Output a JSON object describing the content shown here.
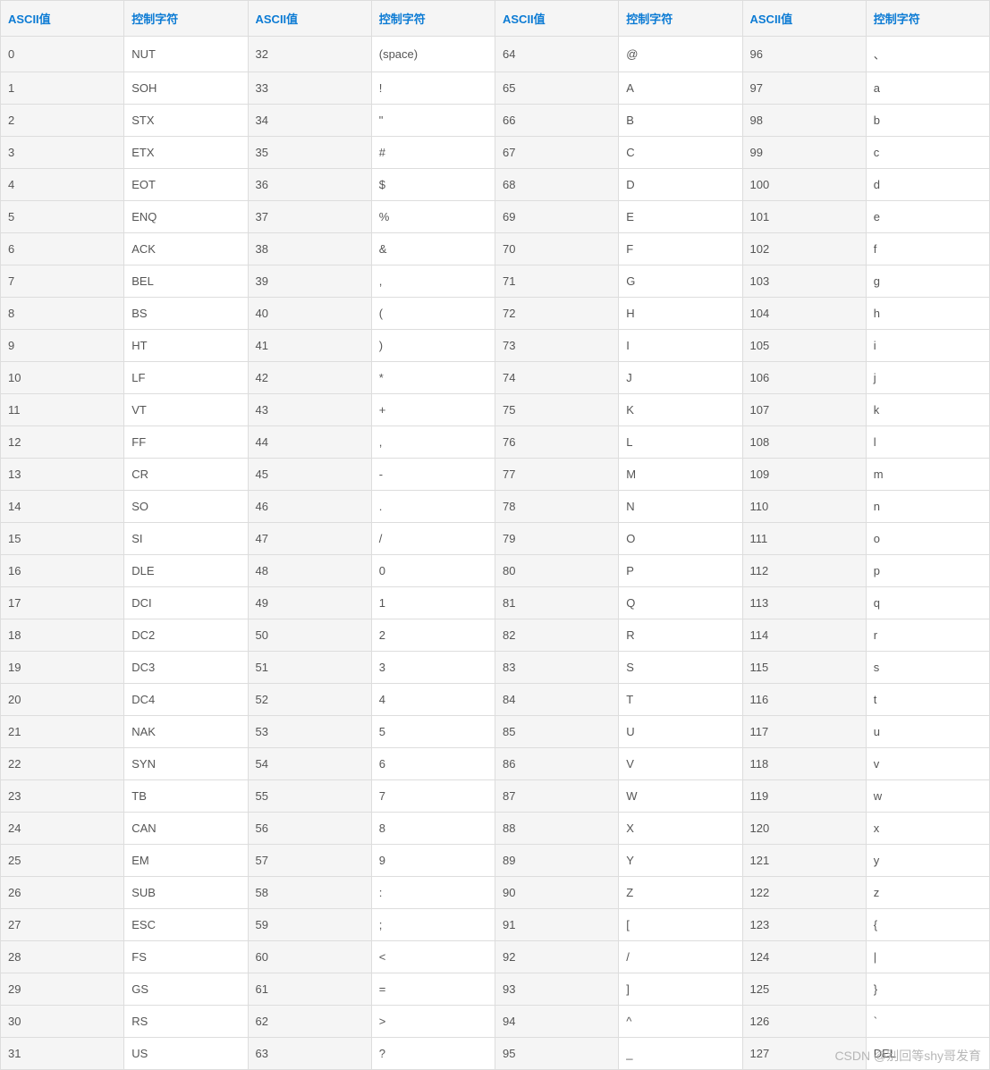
{
  "headers": [
    "ASCII值",
    "控制字符",
    "ASCII值",
    "控制字符",
    "ASCII值",
    "控制字符",
    "ASCII值",
    "控制字符"
  ],
  "rows": [
    [
      "0",
      "NUT",
      "32",
      "(space)",
      "64",
      "@",
      "96",
      "、"
    ],
    [
      "1",
      "SOH",
      "33",
      "!",
      "65",
      "A",
      "97",
      "a"
    ],
    [
      "2",
      "STX",
      "34",
      "\"",
      "66",
      "B",
      "98",
      "b"
    ],
    [
      "3",
      "ETX",
      "35",
      "#",
      "67",
      "C",
      "99",
      "c"
    ],
    [
      "4",
      "EOT",
      "36",
      "$",
      "68",
      "D",
      "100",
      "d"
    ],
    [
      "5",
      "ENQ",
      "37",
      "%",
      "69",
      "E",
      "101",
      "e"
    ],
    [
      "6",
      "ACK",
      "38",
      "&",
      "70",
      "F",
      "102",
      "f"
    ],
    [
      "7",
      "BEL",
      "39",
      ",",
      "71",
      "G",
      "103",
      "g"
    ],
    [
      "8",
      "BS",
      "40",
      "(",
      "72",
      "H",
      "104",
      "h"
    ],
    [
      "9",
      "HT",
      "41",
      ")",
      "73",
      "I",
      "105",
      "i"
    ],
    [
      "10",
      "LF",
      "42",
      "*",
      "74",
      "J",
      "106",
      "j"
    ],
    [
      "11",
      "VT",
      "43",
      "+",
      "75",
      "K",
      "107",
      "k"
    ],
    [
      "12",
      "FF",
      "44",
      ",",
      "76",
      "L",
      "108",
      "l"
    ],
    [
      "13",
      "CR",
      "45",
      "-",
      "77",
      "M",
      "109",
      "m"
    ],
    [
      "14",
      "SO",
      "46",
      ".",
      "78",
      "N",
      "110",
      "n"
    ],
    [
      "15",
      "SI",
      "47",
      "/",
      "79",
      "O",
      "111",
      "o"
    ],
    [
      "16",
      "DLE",
      "48",
      "0",
      "80",
      "P",
      "112",
      "p"
    ],
    [
      "17",
      "DCI",
      "49",
      "1",
      "81",
      "Q",
      "113",
      "q"
    ],
    [
      "18",
      "DC2",
      "50",
      "2",
      "82",
      "R",
      "114",
      "r"
    ],
    [
      "19",
      "DC3",
      "51",
      "3",
      "83",
      "S",
      "115",
      "s"
    ],
    [
      "20",
      "DC4",
      "52",
      "4",
      "84",
      "T",
      "116",
      "t"
    ],
    [
      "21",
      "NAK",
      "53",
      "5",
      "85",
      "U",
      "117",
      "u"
    ],
    [
      "22",
      "SYN",
      "54",
      "6",
      "86",
      "V",
      "118",
      "v"
    ],
    [
      "23",
      "TB",
      "55",
      "7",
      "87",
      "W",
      "119",
      "w"
    ],
    [
      "24",
      "CAN",
      "56",
      "8",
      "88",
      "X",
      "120",
      "x"
    ],
    [
      "25",
      "EM",
      "57",
      "9",
      "89",
      "Y",
      "121",
      "y"
    ],
    [
      "26",
      "SUB",
      "58",
      ":",
      "90",
      "Z",
      "122",
      "z"
    ],
    [
      "27",
      "ESC",
      "59",
      ";",
      "91",
      "[",
      "123",
      "{"
    ],
    [
      "28",
      "FS",
      "60",
      "<",
      "92",
      "/",
      "124",
      "|"
    ],
    [
      "29",
      "GS",
      "61",
      "=",
      "93",
      "]",
      "125",
      "}"
    ],
    [
      "30",
      "RS",
      "62",
      ">",
      "94",
      "^",
      "126",
      "`"
    ],
    [
      "31",
      "US",
      "63",
      "?",
      "95",
      "_",
      "127",
      "DEL"
    ]
  ],
  "watermark": "CSDN @别回等shy哥发育"
}
